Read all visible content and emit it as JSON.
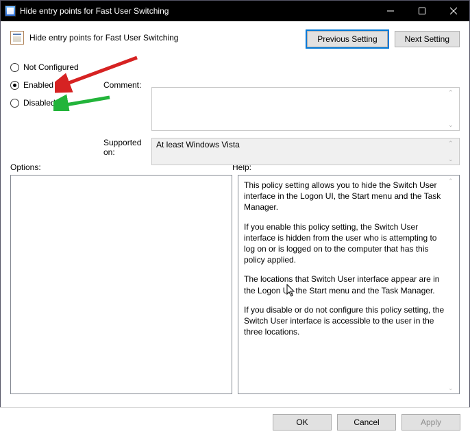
{
  "window": {
    "title": "Hide entry points for Fast User Switching"
  },
  "header": {
    "policy_title": "Hide entry points for Fast User Switching",
    "prev_btn": "Previous Setting",
    "next_btn": "Next Setting"
  },
  "state": {
    "not_configured_label": "Not Configured",
    "enabled_label": "Enabled",
    "disabled_label": "Disabled",
    "selected": "Enabled"
  },
  "fields": {
    "comment_label": "Comment:",
    "comment_value": "",
    "supported_label": "Supported on:",
    "supported_value": "At least Windows Vista"
  },
  "sections": {
    "options_label": "Options:",
    "help_label": "Help:"
  },
  "help": {
    "p1": "This policy setting allows you to hide the Switch User interface in the Logon UI, the Start menu and the Task Manager.",
    "p2": "If you enable this policy setting, the Switch User interface is hidden from the user who is attempting to log on or is logged on to the computer that has this policy applied.",
    "p3": "The locations that Switch User interface appear are in the Logon UI, the Start menu and the Task Manager.",
    "p4": "If you disable or do not configure this policy setting, the Switch User interface is accessible to the user in the three locations."
  },
  "footer": {
    "ok": "OK",
    "cancel": "Cancel",
    "apply": "Apply"
  }
}
